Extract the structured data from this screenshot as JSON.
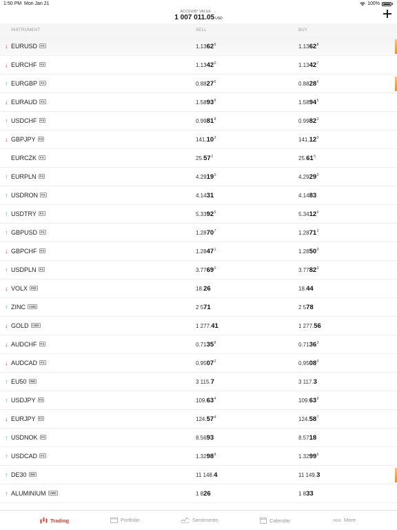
{
  "status_bar": {
    "time": "1:50 PM",
    "date": "Mon Jan 21",
    "battery": "100%"
  },
  "header": {
    "account_label": "ACCOUNT VALUE",
    "account_value": "1 007 011.05",
    "account_currency": "USD"
  },
  "columns": {
    "instrument": "INSTRUMENT",
    "sell": "SELL",
    "buy": "BUY"
  },
  "instruments": [
    {
      "dir": "down",
      "name": "EURUSD",
      "type": "FX",
      "sell": {
        "pre": "1.13",
        "big": "62",
        "sup": "6"
      },
      "buy": {
        "pre": "1.13",
        "big": "62",
        "sup": "8"
      },
      "flash": true
    },
    {
      "dir": "down",
      "name": "EURCHF",
      "type": "FX",
      "sell": {
        "pre": "1.13",
        "big": "42",
        "sup": "0"
      },
      "buy": {
        "pre": "1.13",
        "big": "42",
        "sup": "7"
      },
      "flash": false
    },
    {
      "dir": "up",
      "name": "EURGBP",
      "type": "FX",
      "sell": {
        "pre": "0.88",
        "big": "27",
        "sup": "6"
      },
      "buy": {
        "pre": "0.88",
        "big": "28",
        "sup": "6"
      },
      "flash": true
    },
    {
      "dir": "down",
      "name": "EURAUD",
      "type": "FX",
      "sell": {
        "pre": "1.58",
        "big": "93",
        "sup": "8"
      },
      "buy": {
        "pre": "1.58",
        "big": "94",
        "sup": "5"
      },
      "flash": false
    },
    {
      "dir": "up",
      "name": "USDCHF",
      "type": "FX",
      "sell": {
        "pre": "0.99",
        "big": "81",
        "sup": "8"
      },
      "buy": {
        "pre": "0.99",
        "big": "82",
        "sup": "3"
      },
      "flash": false
    },
    {
      "dir": "down",
      "name": "GBPJPY",
      "type": "FX",
      "sell": {
        "pre": "141.",
        "big": "10",
        "sup": "3"
      },
      "buy": {
        "pre": "141.",
        "big": "12",
        "sup": "0"
      },
      "flash": false
    },
    {
      "dir": "none",
      "name": "EURCZK",
      "type": "FX",
      "sell": {
        "pre": "25.",
        "big": "57",
        "sup": "2"
      },
      "buy": {
        "pre": "25.",
        "big": "61",
        "sup": "5"
      },
      "flash": false
    },
    {
      "dir": "up",
      "name": "EURPLN",
      "type": "FX",
      "sell": {
        "pre": "4.29",
        "big": "19",
        "sup": "0"
      },
      "buy": {
        "pre": "4.29",
        "big": "29",
        "sup": "0"
      },
      "flash": false
    },
    {
      "dir": "up",
      "name": "USDRON",
      "type": "FX",
      "sell": {
        "pre": "4.14",
        "big": "31",
        "sup": ""
      },
      "buy": {
        "pre": "4.14",
        "big": "83",
        "sup": ""
      },
      "flash": false
    },
    {
      "dir": "up",
      "name": "USDTRY",
      "type": "FX",
      "sell": {
        "pre": "5.33",
        "big": "92",
        "sup": "5"
      },
      "buy": {
        "pre": "5.34",
        "big": "12",
        "sup": "6"
      },
      "flash": false
    },
    {
      "dir": "up",
      "name": "GBPUSD",
      "type": "FX",
      "sell": {
        "pre": "1.28",
        "big": "70",
        "sup": "7"
      },
      "buy": {
        "pre": "1.28",
        "big": "71",
        "sup": "3"
      },
      "flash": false
    },
    {
      "dir": "down",
      "name": "GBPCHF",
      "type": "FX",
      "sell": {
        "pre": "1.28",
        "big": "47",
        "sup": "1"
      },
      "buy": {
        "pre": "1.28",
        "big": "50",
        "sup": "0"
      },
      "flash": false
    },
    {
      "dir": "up",
      "name": "USDPLN",
      "type": "FX",
      "sell": {
        "pre": "3.77",
        "big": "69",
        "sup": "0"
      },
      "buy": {
        "pre": "3.77",
        "big": "82",
        "sup": "0"
      },
      "flash": false
    },
    {
      "dir": "down",
      "name": "VOLX",
      "type": "IND",
      "sell": {
        "pre": "18.",
        "big": "26",
        "sup": ""
      },
      "buy": {
        "pre": "18.",
        "big": "44",
        "sup": ""
      },
      "flash": false
    },
    {
      "dir": "up",
      "name": "ZINC",
      "type": "CMD",
      "sell": {
        "pre": "2 5",
        "big": "71",
        "sup": ""
      },
      "buy": {
        "pre": "2 5",
        "big": "78",
        "sup": ""
      },
      "flash": false
    },
    {
      "dir": "down",
      "name": "GOLD",
      "type": "CMD",
      "sell": {
        "pre": "1 277.",
        "big": "41",
        "sup": ""
      },
      "buy": {
        "pre": "1 277.",
        "big": "56",
        "sup": ""
      },
      "flash": false
    },
    {
      "dir": "down",
      "name": "AUDCHF",
      "type": "FX",
      "sell": {
        "pre": "0.71",
        "big": "35",
        "sup": "8"
      },
      "buy": {
        "pre": "0.71",
        "big": "36",
        "sup": "3"
      },
      "flash": false
    },
    {
      "dir": "down",
      "name": "AUDCAD",
      "type": "FX",
      "sell": {
        "pre": "0.95",
        "big": "07",
        "sup": "2"
      },
      "buy": {
        "pre": "0.95",
        "big": "08",
        "sup": "0"
      },
      "flash": false
    },
    {
      "dir": "up",
      "name": "EU50",
      "type": "IND",
      "sell": {
        "pre": "3 115.",
        "big": "7",
        "sup": ""
      },
      "buy": {
        "pre": "3 117.",
        "big": "3",
        "sup": ""
      },
      "flash": false
    },
    {
      "dir": "up",
      "name": "USDJPY",
      "type": "FX",
      "sell": {
        "pre": "109.",
        "big": "63",
        "sup": "4"
      },
      "buy": {
        "pre": "109.",
        "big": "63",
        "sup": "9"
      },
      "flash": false
    },
    {
      "dir": "down",
      "name": "EURJPY",
      "type": "FX",
      "sell": {
        "pre": "124.",
        "big": "57",
        "sup": "4"
      },
      "buy": {
        "pre": "124.",
        "big": "58",
        "sup": "7"
      },
      "flash": false
    },
    {
      "dir": "up",
      "name": "USDNOK",
      "type": "FX",
      "sell": {
        "pre": "8.56",
        "big": "93",
        "sup": ""
      },
      "buy": {
        "pre": "8.57",
        "big": "18",
        "sup": ""
      },
      "flash": false
    },
    {
      "dir": "up",
      "name": "USDCAD",
      "type": "FX",
      "sell": {
        "pre": "1.32",
        "big": "98",
        "sup": "8"
      },
      "buy": {
        "pre": "1.32",
        "big": "99",
        "sup": "6"
      },
      "flash": false
    },
    {
      "dir": "up",
      "name": "DE30",
      "type": "IND",
      "sell": {
        "pre": "11 148.",
        "big": "4",
        "sup": ""
      },
      "buy": {
        "pre": "11 149.",
        "big": "3",
        "sup": ""
      },
      "flash": true
    },
    {
      "dir": "up",
      "name": "ALUMINIUM",
      "type": "CMD",
      "sell": {
        "pre": "1 8",
        "big": "26",
        "sup": ""
      },
      "buy": {
        "pre": "1 8",
        "big": "33",
        "sup": ""
      },
      "flash": false
    }
  ],
  "tabs": {
    "trading": "Trading",
    "portfolio": "Portfolio",
    "sentiments": "Sentiments",
    "calendar": "Calendar",
    "more": "More"
  },
  "colors": {
    "accent": "#d23a2f",
    "down": "#e0302b",
    "up": "#2bb673",
    "flash": "#f08a2c"
  }
}
